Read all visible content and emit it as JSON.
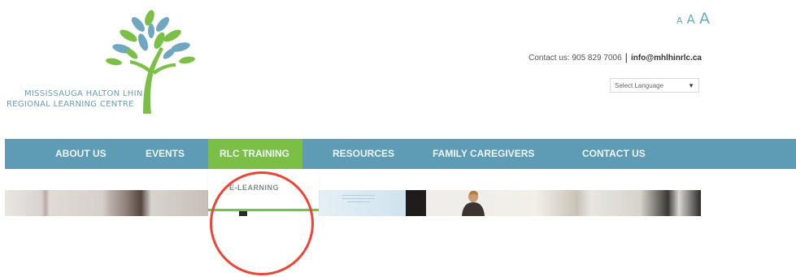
{
  "logo": {
    "line1": "MISSISSAUGA HALTON LHIN",
    "line2": "REGIONAL LEARNING CENTRE"
  },
  "font_size_controls": {
    "small": "A",
    "medium": "A",
    "large": "A"
  },
  "contact": {
    "phone_text": "Contact us: 905 829 7006",
    "separator": "|",
    "email": "info@mhlhinrlc.ca"
  },
  "language_select": {
    "selected": "Select Language",
    "arrow": "▼"
  },
  "nav": {
    "items": [
      {
        "label": "ABOUT US"
      },
      {
        "label": "EVENTS"
      },
      {
        "label": "RLC TRAINING"
      },
      {
        "label": "RESOURCES"
      },
      {
        "label": "FAMILY CAREGIVERS"
      },
      {
        "label": "CONTACT US"
      }
    ],
    "active_index": 2,
    "bar_color": "#5e9cb6",
    "active_color": "#7bbf46"
  },
  "dropdown": {
    "items": [
      {
        "label": "E-LEARNING"
      }
    ]
  },
  "annotation": {
    "color": "#ee4434"
  }
}
